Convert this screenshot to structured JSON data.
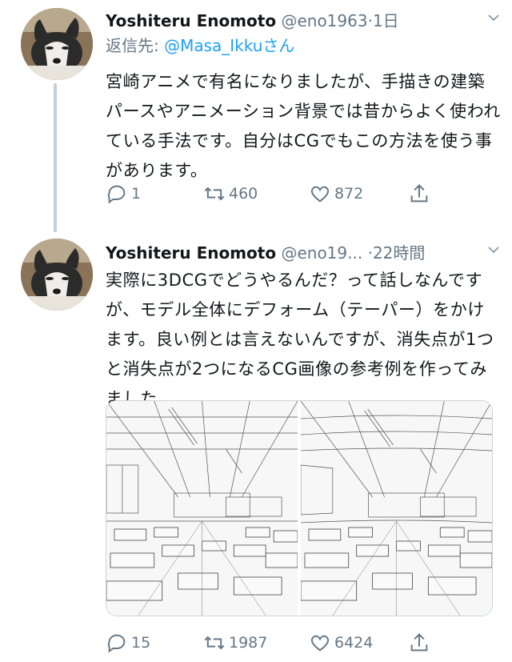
{
  "tweets": [
    {
      "name": "Yoshiteru Enomoto",
      "handle": "@eno1963",
      "time": "1日",
      "reply_label": "返信先:",
      "reply_mention": "@Masa_Ikku",
      "reply_suffix": "さん",
      "text": "宮崎アニメで有名になりましたが、手描きの建築パースやアニメーション背景では昔からよく使われている手法です。自分はCGでもこの方法を使う事があります。",
      "replies": "1",
      "retweets": "460",
      "likes": "872"
    },
    {
      "name": "Yoshiteru Enomoto",
      "handle": "@eno19...",
      "time": "22時間",
      "text": "実際に3DCGでどうやるんだ？って話しなんですが、モデル全体にデフォーム（テーパー）をかけます。良い例とは言えないんですが、消失点が1つと消失点が2つになるCG画像の参考例を作ってみました。",
      "replies": "15",
      "retweets": "1987",
      "likes": "6424"
    }
  ],
  "icons": {
    "reply": "reply-icon",
    "retweet": "retweet-icon",
    "like": "heart-icon",
    "share": "share-icon",
    "caret": "chevron-down-icon"
  },
  "colors": {
    "link": "#1da1f2",
    "muted": "#657786",
    "text": "#14171a",
    "thread_line": "#c4cfd6"
  }
}
